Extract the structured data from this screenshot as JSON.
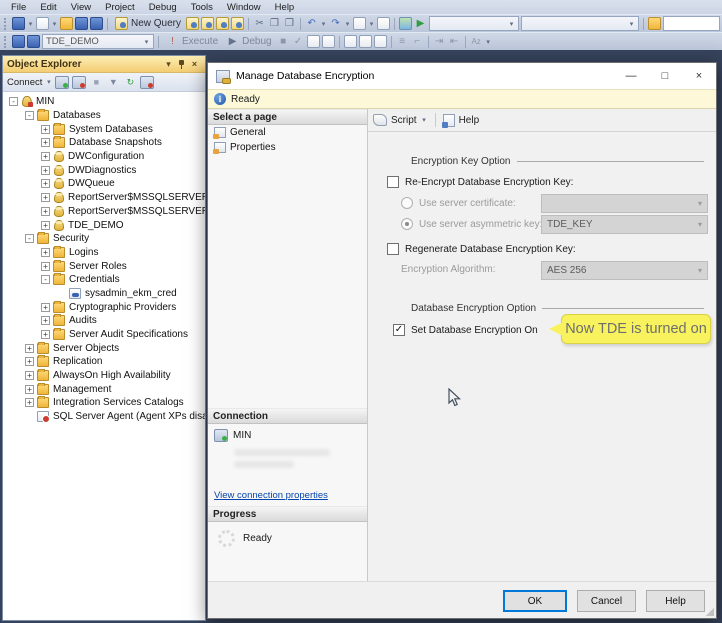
{
  "menu": {
    "items": [
      "File",
      "Edit",
      "View",
      "Project",
      "Debug",
      "Tools",
      "Window",
      "Help"
    ]
  },
  "toolbar": {
    "new_query": "New Query",
    "db_selector_value": "TDE_DEMO",
    "execute": "Execute",
    "debug": "Debug"
  },
  "icons": {
    "cut": "✂",
    "copy": "❐",
    "paste": "❒",
    "undo": "↶",
    "redo": "↷",
    "play": "▶",
    "stop": "■",
    "check": "✓",
    "exclaim": "!",
    "chevron_down": "▾",
    "close": "×",
    "minimize": "—",
    "maximize": "□",
    "filter": "▼",
    "refresh": "↻",
    "indent": "≡",
    "sort": "Az"
  },
  "object_explorer": {
    "title": "Object Explorer",
    "connect": "Connect",
    "tree": [
      {
        "id": "min",
        "label": "MIN",
        "level": 0,
        "expand": "-",
        "icon": "server"
      },
      {
        "id": "databases",
        "label": "Databases",
        "level": 1,
        "expand": "-",
        "icon": "folder"
      },
      {
        "id": "system-databases",
        "label": "System Databases",
        "level": 2,
        "expand": "+",
        "icon": "folder"
      },
      {
        "id": "database-snapshots",
        "label": "Database Snapshots",
        "level": 2,
        "expand": "+",
        "icon": "folder"
      },
      {
        "id": "dwconfiguration",
        "label": "DWConfiguration",
        "level": 2,
        "expand": "+",
        "icon": "database"
      },
      {
        "id": "dwdiagnostics",
        "label": "DWDiagnostics",
        "level": 2,
        "expand": "+",
        "icon": "database"
      },
      {
        "id": "dwqueue",
        "label": "DWQueue",
        "level": 2,
        "expand": "+",
        "icon": "database"
      },
      {
        "id": "reportserver-1",
        "label": "ReportServer$MSSQLSERVER",
        "level": 2,
        "expand": "+",
        "icon": "database"
      },
      {
        "id": "reportserver-2",
        "label": "ReportServer$MSSQLSERVER",
        "level": 2,
        "expand": "+",
        "icon": "database"
      },
      {
        "id": "tde-demo",
        "label": "TDE_DEMO",
        "level": 2,
        "expand": "+",
        "icon": "database"
      },
      {
        "id": "security",
        "label": "Security",
        "level": 1,
        "expand": "-",
        "icon": "folder"
      },
      {
        "id": "logins",
        "label": "Logins",
        "level": 2,
        "expand": "+",
        "icon": "folder"
      },
      {
        "id": "server-roles",
        "label": "Server Roles",
        "level": 2,
        "expand": "+",
        "icon": "folder"
      },
      {
        "id": "credentials",
        "label": "Credentials",
        "level": 2,
        "expand": "-",
        "icon": "folder"
      },
      {
        "id": "sysadmin-ekm-cred",
        "label": "sysadmin_ekm_cred",
        "level": 3,
        "expand": "",
        "icon": "credential"
      },
      {
        "id": "cryptographic-providers",
        "label": "Cryptographic Providers",
        "level": 2,
        "expand": "+",
        "icon": "folder"
      },
      {
        "id": "audits",
        "label": "Audits",
        "level": 2,
        "expand": "+",
        "icon": "folder"
      },
      {
        "id": "server-audit-specifications",
        "label": "Server Audit Specifications",
        "level": 2,
        "expand": "+",
        "icon": "folder"
      },
      {
        "id": "server-objects",
        "label": "Server Objects",
        "level": 1,
        "expand": "+",
        "icon": "folder"
      },
      {
        "id": "replication",
        "label": "Replication",
        "level": 1,
        "expand": "+",
        "icon": "folder"
      },
      {
        "id": "alwayson-high-availability",
        "label": "AlwaysOn High Availability",
        "level": 1,
        "expand": "+",
        "icon": "folder"
      },
      {
        "id": "management",
        "label": "Management",
        "level": 1,
        "expand": "+",
        "icon": "folder"
      },
      {
        "id": "integration-services-catalogs",
        "label": "Integration Services Catalogs",
        "level": 1,
        "expand": "+",
        "icon": "folder"
      },
      {
        "id": "sql-server-agent",
        "label": "SQL Server Agent (Agent XPs disabl",
        "level": 1,
        "expand": "",
        "icon": "agent"
      }
    ]
  },
  "dialog": {
    "title": "Manage Database Encryption",
    "status": "Ready",
    "select_a_page": "Select a page",
    "pages": [
      "General",
      "Properties"
    ],
    "toolbar": {
      "script": "Script",
      "help": "Help"
    },
    "encryption_key_option": {
      "header": "Encryption Key Option",
      "re_encrypt_label": "Re-Encrypt Database Encryption Key:",
      "use_certificate_label": "Use server certificate:",
      "certificate_value": "",
      "use_asymmetric_label": "Use server asymmetric key:",
      "asymmetric_value": "TDE_KEY",
      "regenerate_label": "Regenerate Database Encryption Key:",
      "algorithm_label": "Encryption Algorithm:",
      "algorithm_value": "AES 256"
    },
    "database_encryption_option": {
      "header": "Database Encryption Option",
      "set_on_label": "Set Database Encryption On",
      "callout": "Now TDE is turned on"
    },
    "connection": {
      "header": "Connection",
      "server": "MIN",
      "link": "View connection properties"
    },
    "progress": {
      "header": "Progress",
      "status": "Ready"
    },
    "buttons": {
      "ok": "OK",
      "cancel": "Cancel",
      "help": "Help"
    }
  },
  "colors": {
    "callout_bg": "#f7f25e",
    "ready_bar_bg": "#fcf8d8",
    "oe_title_bg": "#f3cd72",
    "focus_border": "#0078d7"
  }
}
